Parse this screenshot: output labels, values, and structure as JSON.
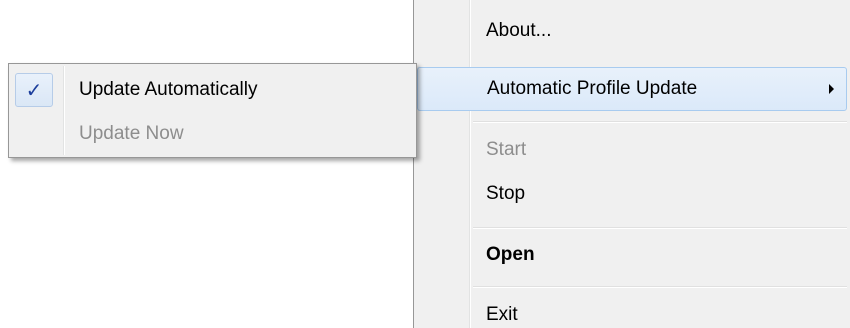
{
  "main_menu": {
    "about_label": "About...",
    "auto_profile_update_label": "Automatic Profile Update",
    "start_label": "Start",
    "stop_label": "Stop",
    "open_label": "Open",
    "exit_label": "Exit"
  },
  "submenu": {
    "update_automatically_label": "Update Automatically",
    "update_automatically_checked": true,
    "update_now_label": "Update Now",
    "check_glyph": "✓"
  },
  "icons": {
    "check": "checkmark-icon",
    "submenu_arrow": "chevron-right-icon"
  },
  "colors": {
    "menu_background": "#f0f0f0",
    "highlight": "#dbe9f9",
    "highlight_border": "#a8cbef",
    "disabled_text": "#8d8d8d",
    "check_color": "#1c3e9c"
  }
}
